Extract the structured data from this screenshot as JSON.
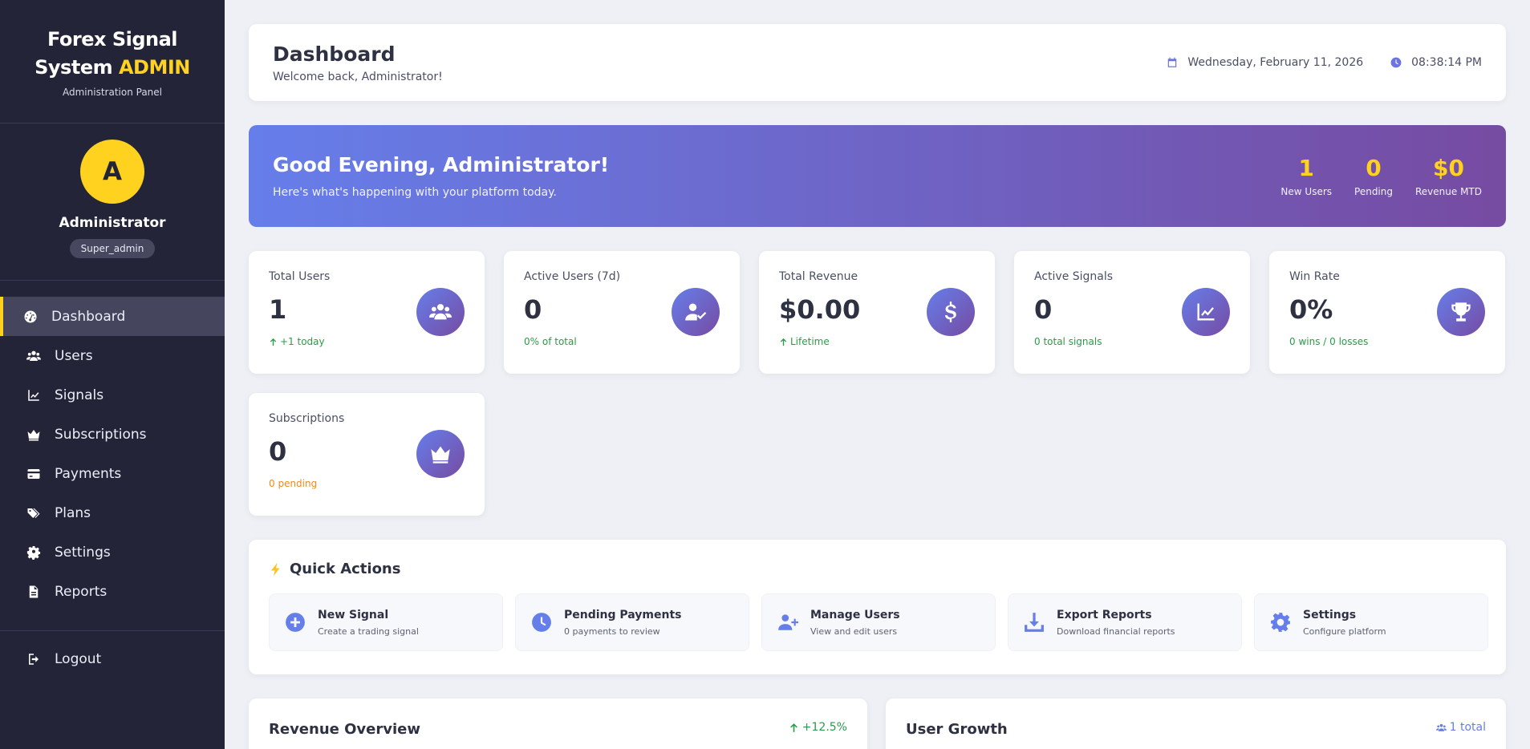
{
  "brand": {
    "title_line1": "Forex Signal",
    "title_line2": "System",
    "title_accent": "ADMIN",
    "subtitle": "Administration Panel"
  },
  "profile": {
    "initial": "A",
    "name": "Administrator",
    "role": "Super_admin"
  },
  "nav": {
    "items": [
      {
        "label": "Dashboard",
        "icon": "gauge-icon",
        "active": true
      },
      {
        "label": "Users",
        "icon": "users-icon"
      },
      {
        "label": "Signals",
        "icon": "chart-line-icon"
      },
      {
        "label": "Subscriptions",
        "icon": "crown-icon"
      },
      {
        "label": "Payments",
        "icon": "credit-card-icon"
      },
      {
        "label": "Plans",
        "icon": "tags-icon"
      },
      {
        "label": "Settings",
        "icon": "gear-icon"
      },
      {
        "label": "Reports",
        "icon": "file-icon"
      }
    ],
    "logout": "Logout"
  },
  "header": {
    "title": "Dashboard",
    "welcome": "Welcome back, Administrator!",
    "date": "Wednesday, February 11, 2026",
    "time": "08:38:14 PM"
  },
  "banner": {
    "greeting": "Good Evening, Administrator!",
    "subtitle": "Here's what's happening with your platform today.",
    "stats": [
      {
        "value": "1",
        "label": "New Users"
      },
      {
        "value": "0",
        "label": "Pending"
      },
      {
        "value": "$0",
        "label": "Revenue MTD"
      }
    ]
  },
  "stats": [
    {
      "label": "Total Users",
      "value": "1",
      "note": "+1 today",
      "icon": "users-icon"
    },
    {
      "label": "Active Users (7d)",
      "value": "0",
      "note": "0% of total",
      "icon": "user-check-icon"
    },
    {
      "label": "Total Revenue",
      "value": "$0.00",
      "note": "Lifetime",
      "icon": "dollar-icon"
    },
    {
      "label": "Active Signals",
      "value": "0",
      "note": "0 total signals",
      "icon": "chart-line-icon"
    },
    {
      "label": "Win Rate",
      "value": "0%",
      "note": "0 wins / 0 losses",
      "icon": "trophy-icon"
    },
    {
      "label": "Subscriptions",
      "value": "0",
      "note": "0 pending",
      "icon": "crown-icon"
    }
  ],
  "quick_actions": {
    "title": "Quick Actions",
    "items": [
      {
        "title": "New Signal",
        "desc": "Create a trading signal",
        "icon": "plus-circle-icon"
      },
      {
        "title": "Pending Payments",
        "desc": "0 payments to review",
        "icon": "clock-icon"
      },
      {
        "title": "Manage Users",
        "desc": "View and edit users",
        "icon": "user-plus-icon"
      },
      {
        "title": "Export Reports",
        "desc": "Download financial reports",
        "icon": "download-icon"
      },
      {
        "title": "Settings",
        "desc": "Configure platform",
        "icon": "gear-icon"
      }
    ]
  },
  "panels": {
    "revenue": {
      "title": "Revenue Overview",
      "badge": "+12.5%"
    },
    "growth": {
      "title": "User Growth",
      "badge": "1 total"
    }
  },
  "colors": {
    "accent": "#ffd21f",
    "gradient_start": "#667eea",
    "gradient_end": "#764ba2",
    "sidebar": "#232438",
    "positive": "#2a9b48",
    "warning": "#f08a19"
  }
}
